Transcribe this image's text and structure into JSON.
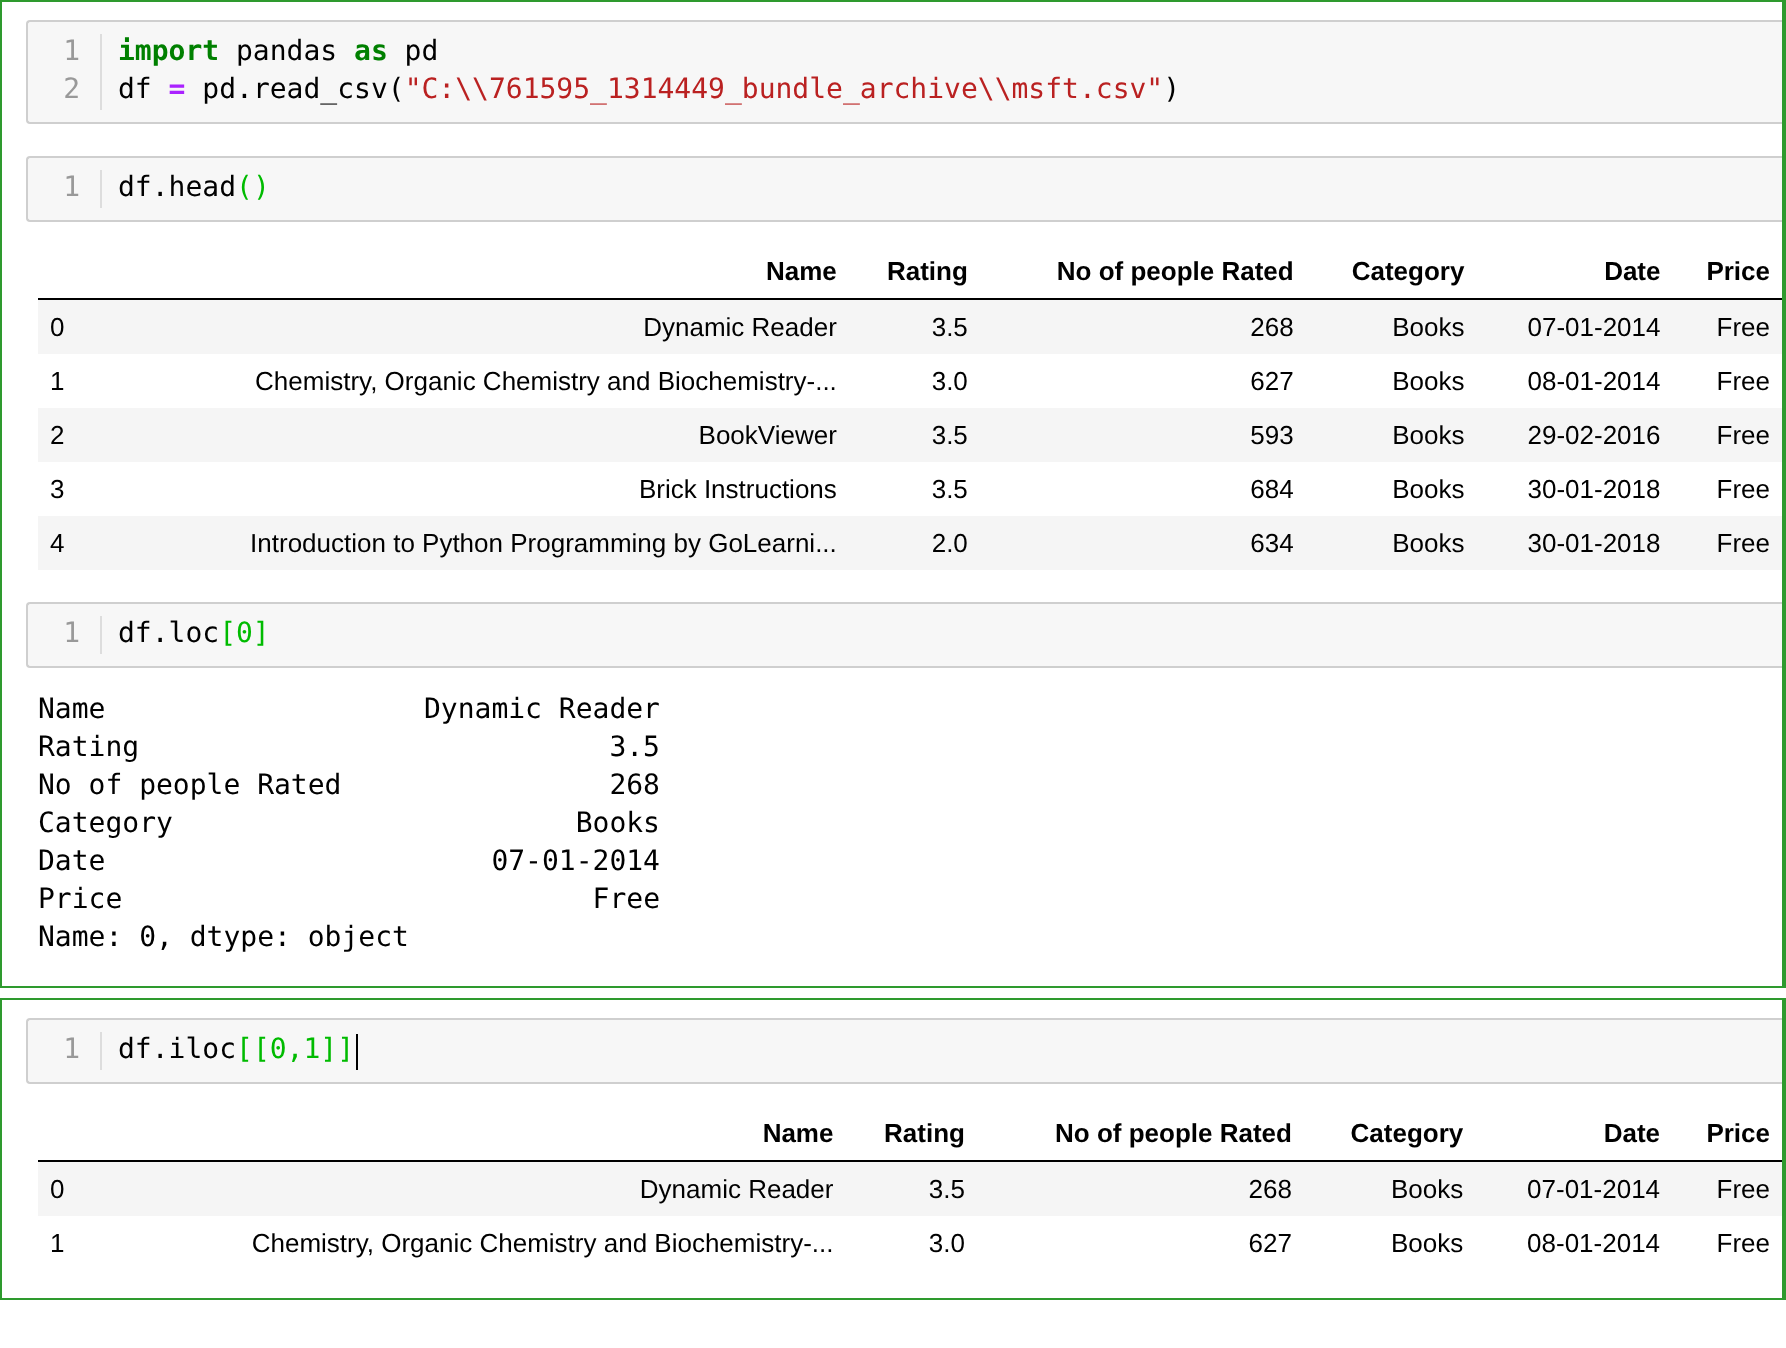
{
  "panels": [
    {
      "cells": [
        {
          "cursor": false,
          "input": [
            {
              "number": "1",
              "tokens": [
                {
                  "kind": "keyword",
                  "text": "import"
                },
                {
                  "kind": "plain",
                  "text": " pandas "
                },
                {
                  "kind": "keyword",
                  "text": "as"
                },
                {
                  "kind": "plain",
                  "text": " pd"
                }
              ]
            },
            {
              "number": "2",
              "tokens": [
                {
                  "kind": "plain",
                  "text": "df "
                },
                {
                  "kind": "operator",
                  "text": "="
                },
                {
                  "kind": "plain",
                  "text": " pd.read_csv("
                },
                {
                  "kind": "string",
                  "text": "\"C:\\\\761595_1314449_bundle_archive\\\\msft.csv\""
                },
                {
                  "kind": "plain",
                  "text": ")"
                }
              ]
            }
          ]
        },
        {
          "cursor": false,
          "input": [
            {
              "number": "1",
              "tokens": [
                {
                  "kind": "plain",
                  "text": "df.head"
                },
                {
                  "kind": "bracket",
                  "text": "()"
                }
              ]
            }
          ],
          "output": {
            "kind": "table",
            "columns": [
              "Name",
              "Rating",
              "No of people Rated",
              "Category",
              "Date",
              "Price"
            ],
            "rows": [
              {
                "index": "0",
                "cells": [
                  "Dynamic Reader",
                  "3.5",
                  "268",
                  "Books",
                  "07-01-2014",
                  "Free"
                ]
              },
              {
                "index": "1",
                "cells": [
                  "Chemistry, Organic Chemistry and Biochemistry-...",
                  "3.0",
                  "627",
                  "Books",
                  "08-01-2014",
                  "Free"
                ]
              },
              {
                "index": "2",
                "cells": [
                  "BookViewer",
                  "3.5",
                  "593",
                  "Books",
                  "29-02-2016",
                  "Free"
                ]
              },
              {
                "index": "3",
                "cells": [
                  "Brick Instructions",
                  "3.5",
                  "684",
                  "Books",
                  "30-01-2018",
                  "Free"
                ]
              },
              {
                "index": "4",
                "cells": [
                  "Introduction to Python Programming by GoLearni...",
                  "2.0",
                  "634",
                  "Books",
                  "30-01-2018",
                  "Free"
                ]
              }
            ]
          }
        },
        {
          "cursor": false,
          "input": [
            {
              "number": "1",
              "tokens": [
                {
                  "kind": "plain",
                  "text": "df.loc"
                },
                {
                  "kind": "bracket",
                  "text": "[0]"
                }
              ]
            }
          ],
          "output": {
            "kind": "series",
            "rows": [
              {
                "label": "Name",
                "value": "Dynamic Reader"
              },
              {
                "label": "Rating",
                "value": "3.5"
              },
              {
                "label": "No of people Rated",
                "value": "268"
              },
              {
                "label": "Category",
                "value": "Books"
              },
              {
                "label": "Date",
                "value": "07-01-2014"
              },
              {
                "label": "Price",
                "value": "Free"
              }
            ],
            "footer": "Name: 0, dtype: object"
          }
        }
      ]
    },
    {
      "cells": [
        {
          "cursor": true,
          "input": [
            {
              "number": "1",
              "tokens": [
                {
                  "kind": "plain",
                  "text": "df.iloc"
                },
                {
                  "kind": "bracket",
                  "text": "[[0,1]]"
                }
              ]
            }
          ],
          "output": {
            "kind": "table",
            "columns": [
              "Name",
              "Rating",
              "No of people Rated",
              "Category",
              "Date",
              "Price"
            ],
            "rows": [
              {
                "index": "0",
                "cells": [
                  "Dynamic Reader",
                  "3.5",
                  "268",
                  "Books",
                  "07-01-2014",
                  "Free"
                ]
              },
              {
                "index": "1",
                "cells": [
                  "Chemistry, Organic Chemistry and Biochemistry-...",
                  "3.0",
                  "627",
                  "Books",
                  "08-01-2014",
                  "Free"
                ]
              }
            ]
          }
        }
      ]
    }
  ]
}
